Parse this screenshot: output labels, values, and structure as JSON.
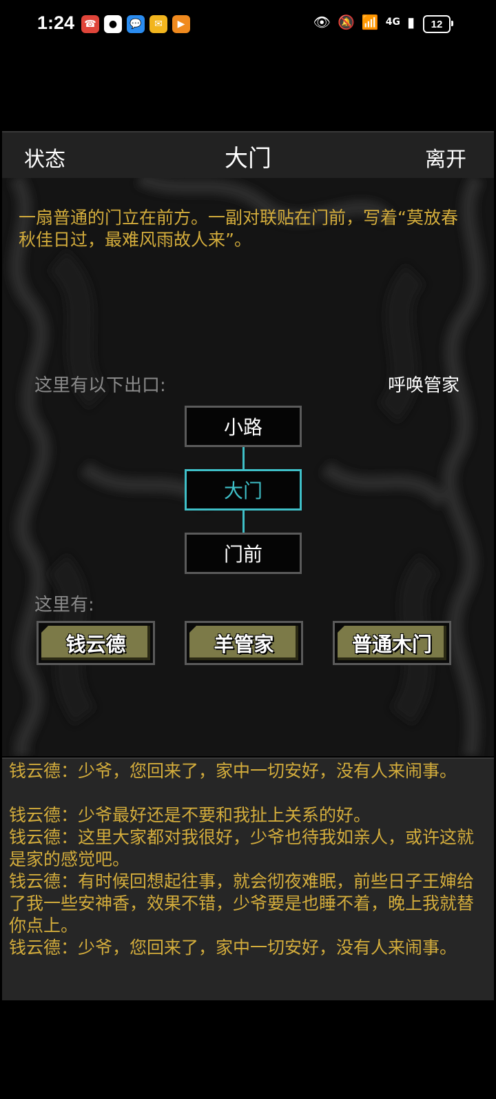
{
  "status_bar": {
    "time": "1:24",
    "notification_icons": [
      "missed-call-icon",
      "qq-icon",
      "message-icon",
      "mail-icon",
      "video-icon"
    ],
    "battery": "12",
    "network": "4G"
  },
  "header": {
    "left_label": "状态",
    "title": "大门",
    "right_label": "离开"
  },
  "scene": {
    "description": "一扇普通的门立在前方。一副对联贴在门前，写着“莫放春秋佳日过，最难风雨故人来”。",
    "exits_label": "这里有以下出口:",
    "call_butler_label": "呼唤管家",
    "rooms": [
      {
        "label": "小路",
        "current": false
      },
      {
        "label": "大门",
        "current": true
      },
      {
        "label": "门前",
        "current": false
      }
    ],
    "here_label": "这里有:",
    "npcs": [
      "钱云德",
      "羊管家",
      "普通木门"
    ]
  },
  "log": {
    "lines": [
      "钱云德：少爷，您回来了，家中一切安好，没有人来闹事。",
      "钱云德：少爷最好还是不要和我扯上关系的好。",
      "钱云德：这里大家都对我很好，少爷也待我如亲人，或许这就是家的感觉吧。",
      "钱云德：有时候回想起往事，就会彻夜难眠，前些日子王婶给了我一些安神香，效果不错，少爷要是也睡不着，晚上我就替你点上。",
      "钱云德：少爷，您回来了，家中一切安好，没有人来闹事。"
    ]
  },
  "colors": {
    "accent_gold": "#d4ad3c",
    "current_room": "#3fc0c8",
    "npc_button": "#7c7a48"
  }
}
